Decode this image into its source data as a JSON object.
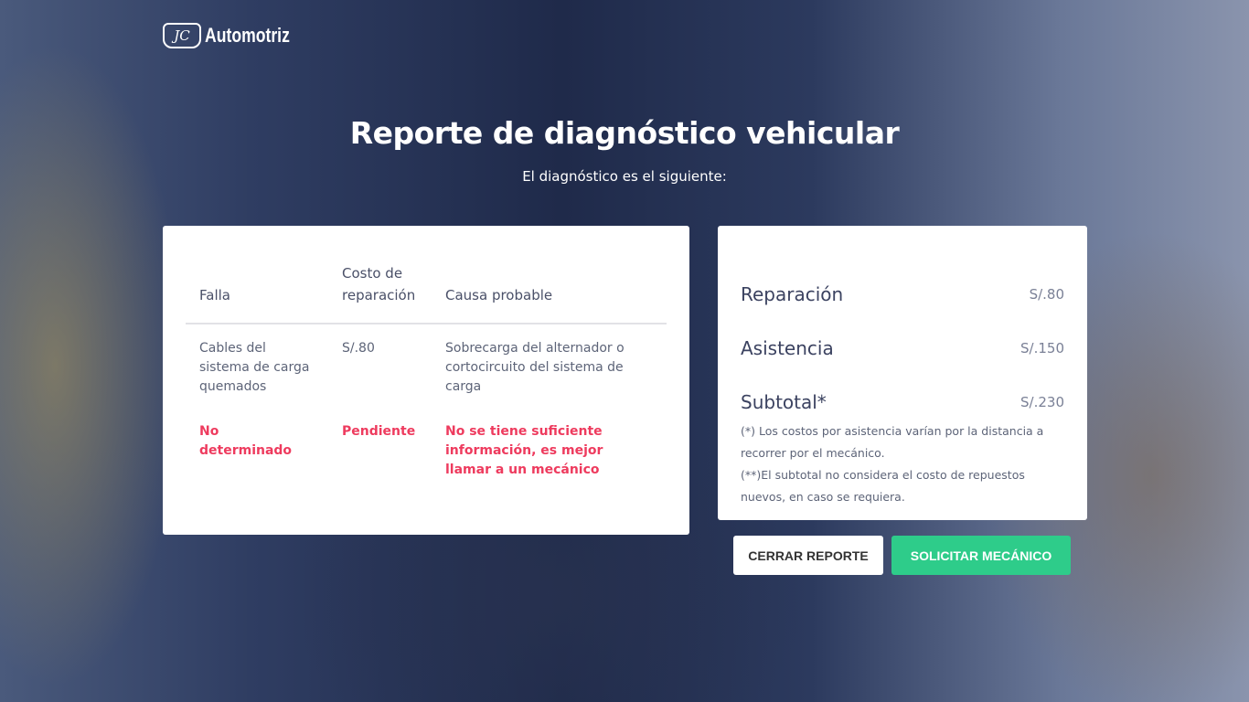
{
  "brand": {
    "monogram": "JC",
    "name": "Automotriz"
  },
  "title": "Reporte de diagnóstico vehicular",
  "subtitle": "El diagnóstico es el siguiente:",
  "table": {
    "headers": [
      "Falla",
      "Costo de reparación",
      "Causa probable"
    ],
    "rows": [
      [
        "Cables del sistema de carga quemados",
        "S/.80",
        "Sobrecarga del alternador o cortocircuito del sistema de carga"
      ],
      [
        "No determinado",
        "Pendiente",
        "No se tiene suficiente información, es mejor llamar a un mecánico"
      ]
    ]
  },
  "summary": {
    "items": [
      {
        "label": "Reparación",
        "value": "S/.80"
      },
      {
        "label": "Asistencia",
        "value": "S/.150"
      },
      {
        "label": "Subtotal*",
        "value": "S/.230"
      }
    ],
    "note1": "(*) Los costos por asistencia varían por la distancia a recorrer por el mecánico.",
    "note2": "(**)El subtotal no considera el costo de repuestos nuevos, en caso se requiera."
  },
  "buttons": {
    "close": "CERRAR REPORTE",
    "request": "SOLICITAR MECÁNICO"
  },
  "colors": {
    "accent": "#2ecc8a",
    "alert": "#ee3b5e"
  }
}
